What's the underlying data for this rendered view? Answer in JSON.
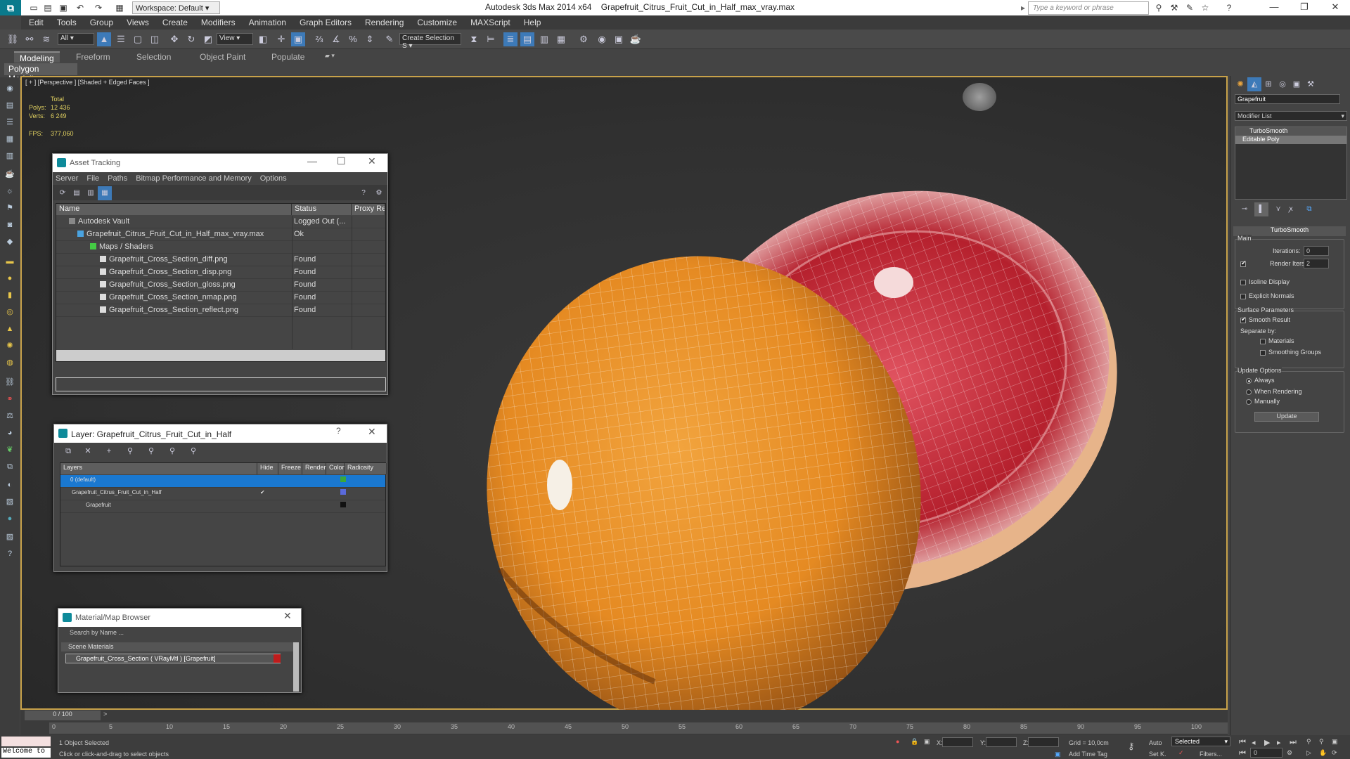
{
  "window": {
    "app_title": "Autodesk 3ds Max  2014 x64",
    "file_title": "Grapefruit_Citrus_Fruit_Cut_in_Half_max_vray.max",
    "workspace": "Workspace: Default",
    "search_placeholder": "Type a keyword or phrase"
  },
  "menu": [
    "Edit",
    "Tools",
    "Group",
    "Views",
    "Create",
    "Modifiers",
    "Animation",
    "Graph Editors",
    "Rendering",
    "Customize",
    "MAXScript",
    "Help"
  ],
  "toolbar": {
    "filter_select": "All",
    "ref_coord_select": "View",
    "named_selection": "Create Selection S"
  },
  "ribbon": {
    "tabs": [
      "Modeling",
      "Freeform",
      "Selection",
      "Object Paint",
      "Populate"
    ],
    "panel_label": "Polygon Modeling"
  },
  "viewport": {
    "label": "[ + ] [Perspective ] [Shaded + Edged Faces ]",
    "stats_total": "Total",
    "polys_label": "Polys:",
    "polys_value": "12 436",
    "verts_label": "Verts:",
    "verts_value": "6 249",
    "fps_label": "FPS:",
    "fps_value": "377,060"
  },
  "asset_tracking": {
    "title": "Asset Tracking",
    "menu": [
      "Server",
      "File",
      "Paths",
      "Bitmap Performance and Memory",
      "Options"
    ],
    "columns": [
      "Name",
      "Status",
      "Proxy Res"
    ],
    "rows": [
      {
        "name": "Autodesk Vault",
        "status": "Logged Out (..."
      },
      {
        "name": "Grapefruit_Citrus_Fruit_Cut_in_Half_max_vray.max",
        "status": "Ok"
      },
      {
        "name": "Maps / Shaders",
        "status": ""
      },
      {
        "name": "Grapefruit_Cross_Section_diff.png",
        "status": "Found"
      },
      {
        "name": "Grapefruit_Cross_Section_disp.png",
        "status": "Found"
      },
      {
        "name": "Grapefruit_Cross_Section_gloss.png",
        "status": "Found"
      },
      {
        "name": "Grapefruit_Cross_Section_nmap.png",
        "status": "Found"
      },
      {
        "name": "Grapefruit_Cross_Section_reflect.png",
        "status": "Found"
      }
    ]
  },
  "layer_window": {
    "title": "Layer: Grapefruit_Citrus_Fruit_Cut_in_Half",
    "help": "?",
    "columns": [
      "Layers",
      "Hide",
      "Freeze",
      "Render",
      "Color",
      "Radiosity"
    ],
    "rows": [
      {
        "name": "0 (default)",
        "color": "#3aa83a"
      },
      {
        "name": "Grapefruit_Citrus_Fruit_Cut_in_Half",
        "color": "#5a6adc"
      },
      {
        "name": "Grapefruit",
        "color": "#111111"
      }
    ]
  },
  "material_browser": {
    "title": "Material/Map Browser",
    "search_placeholder": "Search by Name ...",
    "section": "Scene Materials",
    "item": "Grapefruit_Cross_Section ( VRayMtl ) [Grapefruit]"
  },
  "command_panel": {
    "object_name": "Grapefruit",
    "modifier_list": "Modifier List",
    "stack": [
      "TurboSmooth",
      "Editable Poly"
    ],
    "rollout_title": "TurboSmooth",
    "main_label": "Main",
    "iterations_label": "Iterations:",
    "iterations_value": "0",
    "render_iters_label": "Render Iters:",
    "render_iters_value": "2",
    "isoline": "Isoline Display",
    "explicit_normals": "Explicit Normals",
    "surface_params": "Surface Parameters",
    "smooth_result": "Smooth Result",
    "separate_by": "Separate by:",
    "materials": "Materials",
    "smoothing_groups": "Smoothing Groups",
    "update_options": "Update Options",
    "always": "Always",
    "when_rendering": "When Rendering",
    "manually": "Manually",
    "update_button": "Update"
  },
  "timeline": {
    "frame": "0 / 100",
    "ticks": [
      "0",
      "5",
      "10",
      "15",
      "20",
      "25",
      "30",
      "35",
      "40",
      "45",
      "50",
      "55",
      "60",
      "65",
      "70",
      "75",
      "80",
      "85",
      "90",
      "95",
      "100"
    ]
  },
  "status": {
    "maxscript": "Welcome to",
    "selected_text": "1 Object Selected",
    "prompt": "Click or click-and-drag to select objects",
    "x_label": "X:",
    "y_label": "Y:",
    "z_label": "Z:",
    "grid": "Grid = 10,0cm",
    "add_time_tag": "Add Time Tag",
    "auto": "Auto",
    "set_key": "Set K.",
    "key_filter": "Selected",
    "filters": "Filters...",
    "frame_field": "0"
  }
}
